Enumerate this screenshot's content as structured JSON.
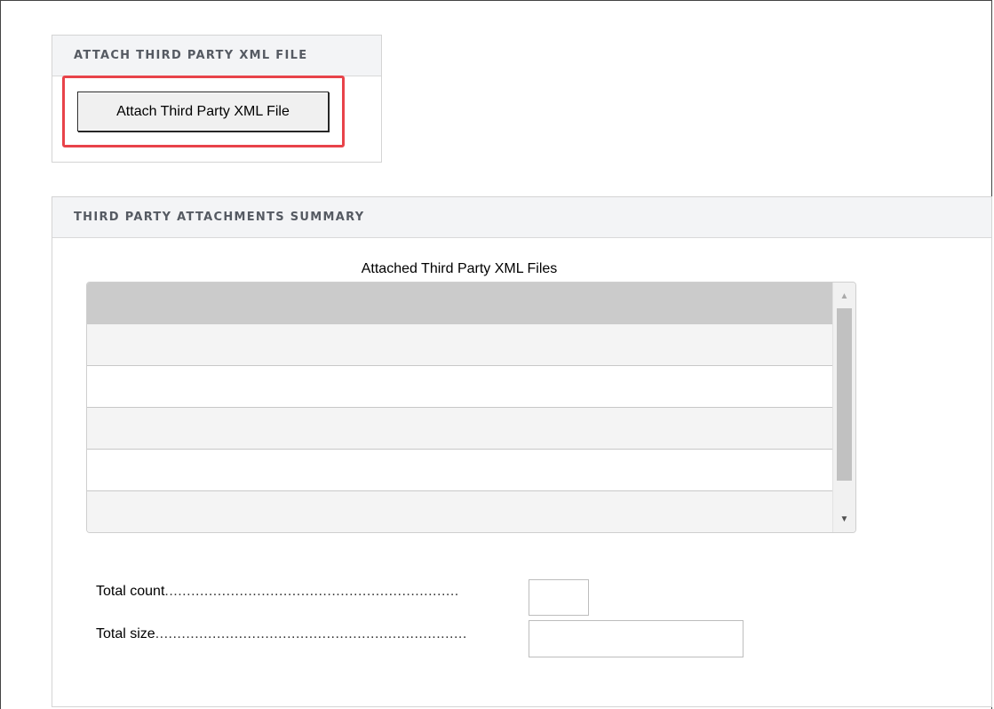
{
  "attach_panel": {
    "title": "ATTACH THIRD PARTY XML FILE",
    "button_label": "Attach Third Party XML File"
  },
  "summary_panel": {
    "title": "THIRD PARTY ATTACHMENTS SUMMARY",
    "list_title": "Attached Third Party XML Files",
    "rows": [
      "",
      "",
      "",
      "",
      "",
      ""
    ],
    "selected_row": 0,
    "scroll_up_icon": "▲",
    "scroll_down_icon": "▼"
  },
  "totals": {
    "count_label": "Total count",
    "count_dots": "...................................................................",
    "count_value": "",
    "size_label": "Total size",
    "size_dots": ".......................................................................",
    "size_value": ""
  },
  "colors": {
    "highlight": "#e8434a",
    "header_bg": "#f3f4f6",
    "header_text": "#555a62",
    "selected_row": "#cbcbcb"
  }
}
